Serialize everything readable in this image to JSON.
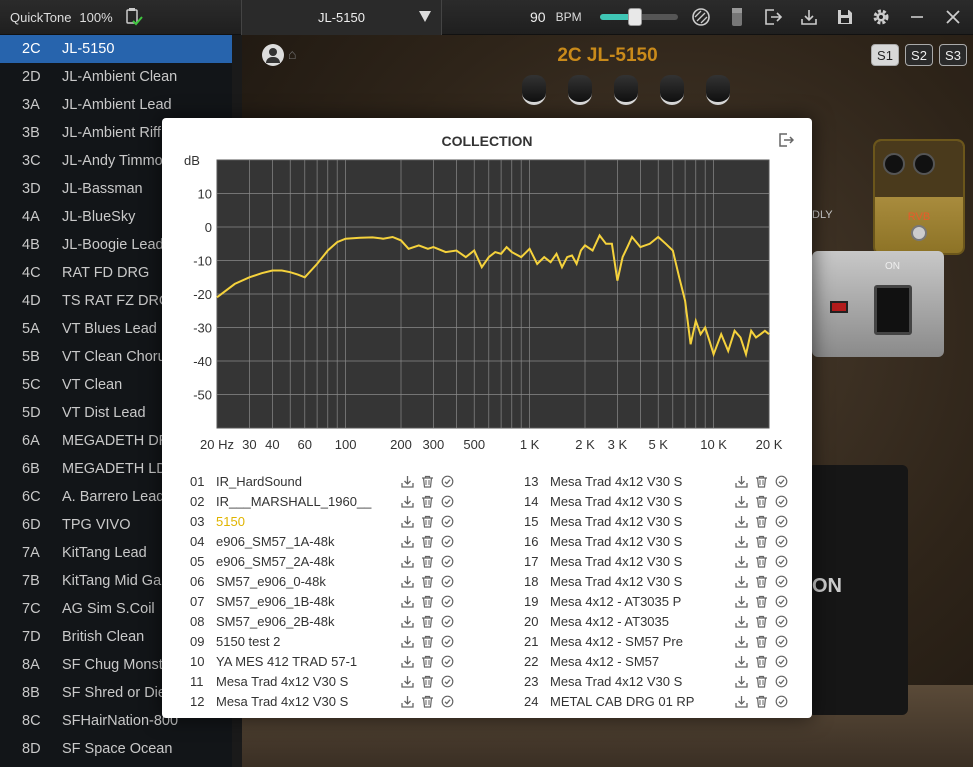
{
  "topbar": {
    "app_name": "QuickTone",
    "zoom": "100%",
    "preset_name": "JL-5150",
    "bpm_value": "90",
    "bpm_label": "BPM",
    "volume_level": 0.46
  },
  "sidebar": {
    "items": [
      {
        "code": "2C",
        "name": "JL-5150",
        "active": true
      },
      {
        "code": "2D",
        "name": "JL-Ambient Clean"
      },
      {
        "code": "3A",
        "name": "JL-Ambient Lead"
      },
      {
        "code": "3B",
        "name": "JL-Ambient Riff"
      },
      {
        "code": "3C",
        "name": "JL-Andy Timmo"
      },
      {
        "code": "3D",
        "name": "JL-Bassman"
      },
      {
        "code": "4A",
        "name": "JL-BlueSky"
      },
      {
        "code": "4B",
        "name": "JL-Boogie Lead"
      },
      {
        "code": "4C",
        "name": "RAT FD DRG"
      },
      {
        "code": "4D",
        "name": "TS RAT FZ DRG"
      },
      {
        "code": "5A",
        "name": "VT Blues Lead"
      },
      {
        "code": "5B",
        "name": "VT Clean Choru"
      },
      {
        "code": "5C",
        "name": "VT Clean"
      },
      {
        "code": "5D",
        "name": "VT Dist Lead"
      },
      {
        "code": "6A",
        "name": "MEGADETH DR"
      },
      {
        "code": "6B",
        "name": "MEGADETH LD"
      },
      {
        "code": "6C",
        "name": "A. Barrero Lead"
      },
      {
        "code": "6D",
        "name": "TPG VIVO"
      },
      {
        "code": "7A",
        "name": "KitTang Lead"
      },
      {
        "code": "7B",
        "name": "KitTang Mid Ga"
      },
      {
        "code": "7C",
        "name": "AG Sim S.Coil"
      },
      {
        "code": "7D",
        "name": "British Clean"
      },
      {
        "code": "8A",
        "name": "SF Chug Monst"
      },
      {
        "code": "8B",
        "name": "SF Shred or Die"
      },
      {
        "code": "8C",
        "name": "SFHairNation-800"
      },
      {
        "code": "8D",
        "name": "SF Space Ocean"
      }
    ]
  },
  "stage": {
    "title": "2C JL-5150",
    "scenes": [
      "S1",
      "S2",
      "S3"
    ],
    "active_scene": "S1",
    "dly_label": "DLY",
    "on_label": "ON",
    "pedal_label": "RVB",
    "cab_text": "ON"
  },
  "modal": {
    "title": "COLLECTION",
    "ir_left": [
      {
        "num": "01",
        "name": "IR_HardSound"
      },
      {
        "num": "02",
        "name": "IR___MARSHALL_1960__"
      },
      {
        "num": "03",
        "name": "5150",
        "selected": true
      },
      {
        "num": "04",
        "name": "e906_SM57_1A-48k"
      },
      {
        "num": "05",
        "name": "e906_SM57_2A-48k"
      },
      {
        "num": "06",
        "name": "SM57_e906_0-48k"
      },
      {
        "num": "07",
        "name": "SM57_e906_1B-48k"
      },
      {
        "num": "08",
        "name": "SM57_e906_2B-48k"
      },
      {
        "num": "09",
        "name": "5150 test 2"
      },
      {
        "num": "10",
        "name": "YA MES 412 TRAD 57-1"
      },
      {
        "num": "11",
        "name": "Mesa Trad 4x12 V30 S"
      },
      {
        "num": "12",
        "name": "Mesa Trad 4x12 V30 S"
      }
    ],
    "ir_right": [
      {
        "num": "13",
        "name": "Mesa Trad 4x12 V30 S"
      },
      {
        "num": "14",
        "name": "Mesa Trad 4x12 V30 S"
      },
      {
        "num": "15",
        "name": "Mesa Trad 4x12 V30 S"
      },
      {
        "num": "16",
        "name": "Mesa Trad 4x12 V30 S"
      },
      {
        "num": "17",
        "name": "Mesa Trad 4x12 V30 S"
      },
      {
        "num": "18",
        "name": "Mesa Trad 4x12 V30 S"
      },
      {
        "num": "19",
        "name": "Mesa 4x12 - AT3035 P"
      },
      {
        "num": "20",
        "name": "Mesa 4x12 - AT3035"
      },
      {
        "num": "21",
        "name": "Mesa 4x12 - SM57 Pre"
      },
      {
        "num": "22",
        "name": "Mesa 4x12 - SM57"
      },
      {
        "num": "23",
        "name": "Mesa Trad 4x12 V30 S"
      },
      {
        "num": "24",
        "name": "METAL CAB DRG 01 RP"
      }
    ]
  },
  "chart_data": {
    "type": "line",
    "ylabel": "dB",
    "ylim": [
      -60,
      20
    ],
    "xlim": [
      20,
      20000
    ],
    "x_scale": "log",
    "grid": true,
    "y_ticks": [
      10,
      0,
      -10,
      -20,
      -30,
      -40,
      -50
    ],
    "x_ticks": [
      {
        "v": 20,
        "label": "20 Hz"
      },
      {
        "v": 30,
        "label": "30"
      },
      {
        "v": 40,
        "label": "40"
      },
      {
        "v": 60,
        "label": "60"
      },
      {
        "v": 100,
        "label": "100"
      },
      {
        "v": 200,
        "label": "200"
      },
      {
        "v": 300,
        "label": "300"
      },
      {
        "v": 500,
        "label": "500"
      },
      {
        "v": 1000,
        "label": "1 K"
      },
      {
        "v": 2000,
        "label": "2 K"
      },
      {
        "v": 3000,
        "label": "3 K"
      },
      {
        "v": 5000,
        "label": "5 K"
      },
      {
        "v": 10000,
        "label": "10 K"
      },
      {
        "v": 20000,
        "label": "20 K"
      }
    ],
    "colors": {
      "line": "#f5d23c",
      "plot_bg": "#353535",
      "grid": "#8a8a8a"
    },
    "series": [
      {
        "x": [
          20,
          25,
          30,
          35,
          40,
          45,
          50,
          55,
          60,
          70,
          80,
          90,
          100,
          120,
          140,
          160,
          180,
          200,
          220,
          250,
          280,
          300,
          350,
          400,
          450,
          500,
          550,
          600,
          650,
          700,
          750,
          800,
          900,
          1000,
          1100,
          1200,
          1300,
          1400,
          1500,
          1600,
          1700,
          1800,
          1900,
          2000,
          2200,
          2400,
          2600,
          2800,
          3000,
          3200,
          3400,
          3600,
          3800,
          4000,
          4500,
          5000,
          5500,
          6000,
          6500,
          7000,
          7500,
          8000,
          8500,
          9000,
          9500,
          10000,
          11000,
          12000,
          13000,
          14000,
          15000,
          16000,
          17000,
          18000,
          19000,
          20000
        ],
        "y": [
          -21,
          -17,
          -15,
          -13.8,
          -13,
          -13,
          -13.5,
          -14.2,
          -15,
          -11,
          -7,
          -4.5,
          -3.5,
          -3.2,
          -3.1,
          -3.5,
          -3,
          -4,
          -6.5,
          -5.5,
          -6.5,
          -6,
          -7.5,
          -7,
          -9,
          -7,
          -12,
          -9,
          -7.5,
          -8,
          -6,
          -7.5,
          -9,
          -6.5,
          -11,
          -9,
          -10.5,
          -8,
          -12,
          -9,
          -8.5,
          -11,
          -7,
          -5.5,
          -7,
          -2.5,
          -5,
          -5,
          -16,
          -9,
          -6,
          -3,
          -4.5,
          -6,
          -5,
          -3,
          -5,
          -7,
          -15,
          -22,
          -35,
          -28,
          -32,
          -30,
          -34,
          -38,
          -32,
          -37,
          -31,
          -33,
          -38,
          -31,
          -33,
          -32,
          -31,
          -32
        ]
      }
    ]
  }
}
